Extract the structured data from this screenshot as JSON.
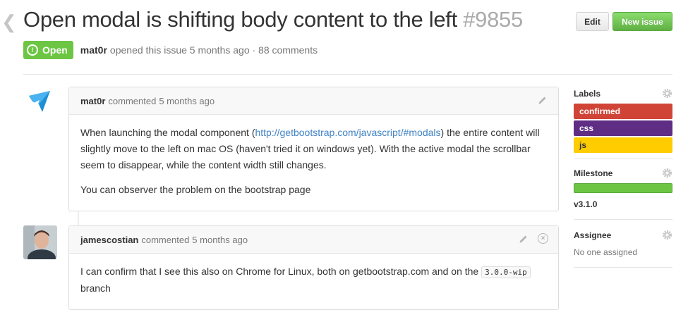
{
  "issue": {
    "title": "Open modal is shifting body content to the left",
    "number": "#9855",
    "state": "Open",
    "author": "mat0r",
    "opened_text": "opened this issue 5 months ago · 88 comments"
  },
  "buttons": {
    "edit": "Edit",
    "new_issue": "New issue"
  },
  "comments": [
    {
      "author": "mat0r",
      "action": "commented",
      "time": "5 months ago",
      "body1_pre": "When launching the modal component (",
      "body1_link": "http://getbootstrap.com/javascript/#modals",
      "body1_post": ") the entire content will slightly move to the left on mac OS (haven't tried it on windows yet). With the active modal the scrollbar seem to disappear, while the content width still changes.",
      "body2": "You can observer the problem on the bootstrap page"
    },
    {
      "author": "jamescostian",
      "action": "commented",
      "time": "5 months ago",
      "body_pre": "I can confirm that I see this also on Chrome for Linux, both on getbootstrap.com and on the",
      "body_code": "3.0.0-wip",
      "body_post": "branch"
    }
  ],
  "sidebar": {
    "labels_title": "Labels",
    "labels": [
      {
        "name": "confirmed",
        "color": "#d04437",
        "text_color": "#ffffff"
      },
      {
        "name": "css",
        "color": "#5f2d84",
        "text_color": "#ffffff"
      },
      {
        "name": "js",
        "color": "#ffcc00",
        "text_color": "#333333"
      }
    ],
    "milestone_title": "Milestone",
    "milestone_progress": 1.0,
    "milestone_name": "v3.1.0",
    "assignee_title": "Assignee",
    "assignee_value": "No one assigned"
  },
  "colors": {
    "open_badge": "#6cc644",
    "new_issue_button": "#60b044",
    "link": "#4183c4"
  },
  "icons": [
    "chevron-left-icon",
    "issue-opened-icon",
    "pencil-icon",
    "close-icon",
    "gear-icon",
    "bootstrap-logo-icon"
  ]
}
